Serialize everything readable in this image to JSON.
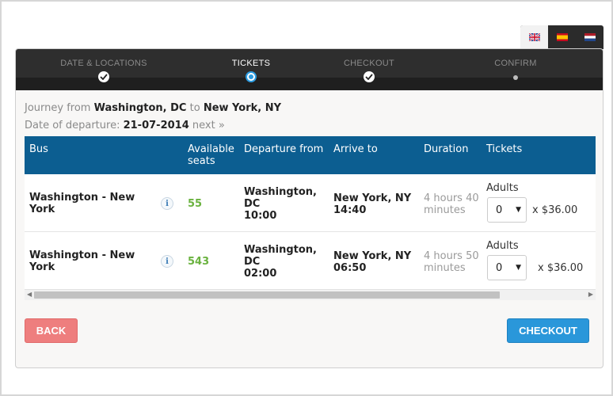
{
  "languages": [
    {
      "name": "english",
      "icon": "uk-flag-icon"
    },
    {
      "name": "spanish",
      "icon": "spain-flag-icon"
    },
    {
      "name": "dutch",
      "icon": "netherlands-flag-icon"
    }
  ],
  "steps": [
    {
      "label": "DATE & LOCATIONS",
      "state": "done"
    },
    {
      "label": "TICKETS",
      "state": "current"
    },
    {
      "label": "CHECKOUT",
      "state": "done"
    },
    {
      "label": "CONFIRM",
      "state": "pending"
    }
  ],
  "journey": {
    "prefix": "Journey from",
    "from": "Washington, DC",
    "to_word": "to",
    "to": "New York, NY",
    "date_label": "Date of departure:",
    "date": "21-07-2014",
    "next_link": "next »"
  },
  "table": {
    "headers": [
      "Bus",
      "Available seats",
      "Departure from",
      "Arrive to",
      "Duration",
      "Tickets"
    ],
    "rows": [
      {
        "bus": "Washington - New York",
        "seats": "55",
        "departure_city": "Washington, DC",
        "departure_time": "10:00",
        "arrive_city": "New York, NY",
        "arrive_time": "14:40",
        "duration": "4 hours 40 minutes",
        "ticket_type": "Adults",
        "qty": "0",
        "price": "x $36.00"
      },
      {
        "bus": "Washington - New York",
        "seats": "543",
        "departure_city": "Washington, DC",
        "departure_time": "02:00",
        "arrive_city": "New York, NY",
        "arrive_time": "06:50",
        "duration": "4 hours 50 minutes",
        "ticket_type": "Adults",
        "qty": "0",
        "price": "x $36.00"
      }
    ]
  },
  "buttons": {
    "back": "BACK",
    "checkout": "CHECKOUT"
  },
  "colors": {
    "header_blue": "#0c5e91",
    "seats_green": "#6ab23f",
    "back_red": "#ee7e7e",
    "checkout_blue": "#2a97da"
  }
}
